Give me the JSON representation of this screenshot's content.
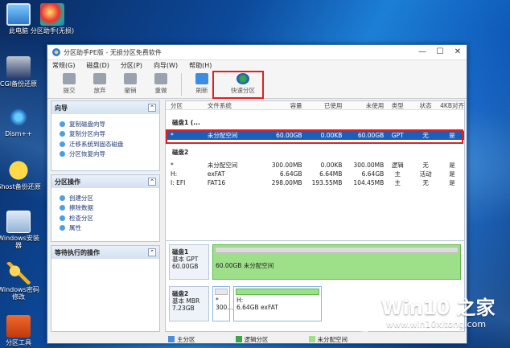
{
  "desktop": {
    "icons": [
      {
        "label": "此电脑",
        "icon": "computer-icon"
      },
      {
        "label": "分区助手(无损)",
        "icon": "partition-assistant-icon"
      },
      {
        "label": "CGI备份还原",
        "icon": "backup-restore-icon"
      },
      {
        "label": "Dism++",
        "icon": "gear-icon"
      },
      {
        "label": "Ghost备份还原",
        "icon": "ghost-icon"
      },
      {
        "label": "Windows安装器",
        "icon": "windows-installer-icon"
      },
      {
        "label": "Windows密码修改",
        "icon": "key-icon"
      },
      {
        "label": "分区工具",
        "icon": "partition-tool-icon"
      }
    ]
  },
  "window": {
    "title": "分区助手PE版 - 无损分区免费软件",
    "controls": {
      "minimize": "—",
      "maximize": "☐",
      "close": "✕"
    }
  },
  "menu": [
    "常规(G)",
    "磁盘(D)",
    "分区(P)",
    "向导(W)",
    "帮助(H)"
  ],
  "toolbar": {
    "buttons": [
      {
        "label": "提交",
        "icon": "commit-icon"
      },
      {
        "label": "放弃",
        "icon": "discard-icon"
      },
      {
        "label": "撤销",
        "icon": "undo-icon"
      },
      {
        "label": "重做",
        "icon": "redo-icon"
      },
      {
        "label": "刷新",
        "icon": "refresh-icon"
      },
      {
        "label": "快速分区",
        "icon": "quick-partition-icon"
      }
    ]
  },
  "left_panels": {
    "wizard": {
      "title": "向导",
      "items": [
        "复制磁盘向导",
        "复制分区向导",
        "迁移系统到固态磁盘",
        "分区恢复向导"
      ]
    },
    "partition_ops": {
      "title": "分区操作",
      "items": [
        "创建分区",
        "擦除数据",
        "检查分区",
        "属性"
      ]
    },
    "pending": {
      "title": "等待执行的操作"
    }
  },
  "partition_table": {
    "columns": [
      "分区",
      "文件系统",
      "容量",
      "已使用",
      "未使用",
      "类型",
      "状态",
      "4KB对齐"
    ],
    "disks": [
      {
        "label": "磁盘1 (...",
        "rows": [
          [
            "*",
            "未分配空间",
            "60.00GB",
            "0.00KB",
            "60.00GB",
            "GPT",
            "无",
            "是"
          ]
        ]
      },
      {
        "label": "磁盘2",
        "rows": [
          [
            "*",
            "未分配空间",
            "300.00MB",
            "0.00KB",
            "300.00MB",
            "逻辑",
            "无",
            "是"
          ],
          [
            "H:",
            "exFAT",
            "6.64GB",
            "6.64MB",
            "6.64GB",
            "主",
            "活动",
            "是"
          ],
          [
            "I: EFI",
            "FAT16",
            "298.00MB",
            "193.55MB",
            "104.45MB",
            "主",
            "无",
            "是"
          ]
        ]
      }
    ]
  },
  "disk_map": {
    "disk1": {
      "name": "磁盘1",
      "type": "基本 GPT",
      "size": "60.00GB",
      "part_label": "",
      "part_desc": "60.00GB 未分配空间"
    },
    "disk2": {
      "name": "磁盘2",
      "type": "基本 MBR",
      "size": "7.23GB",
      "part_a_label": "*",
      "part_a_size": "300...",
      "part_b_label": "H:",
      "part_b_desc": "6.64GB exFAT"
    }
  },
  "legend": [
    {
      "label": "主分区",
      "color": "#4a8ee0"
    },
    {
      "label": "逻辑分区",
      "color": "#3aa64a"
    },
    {
      "label": "未分配空间",
      "color": "#9ee08a"
    }
  ],
  "watermark": {
    "title": "Win10 之家",
    "url": "www.win10xitong.com"
  }
}
